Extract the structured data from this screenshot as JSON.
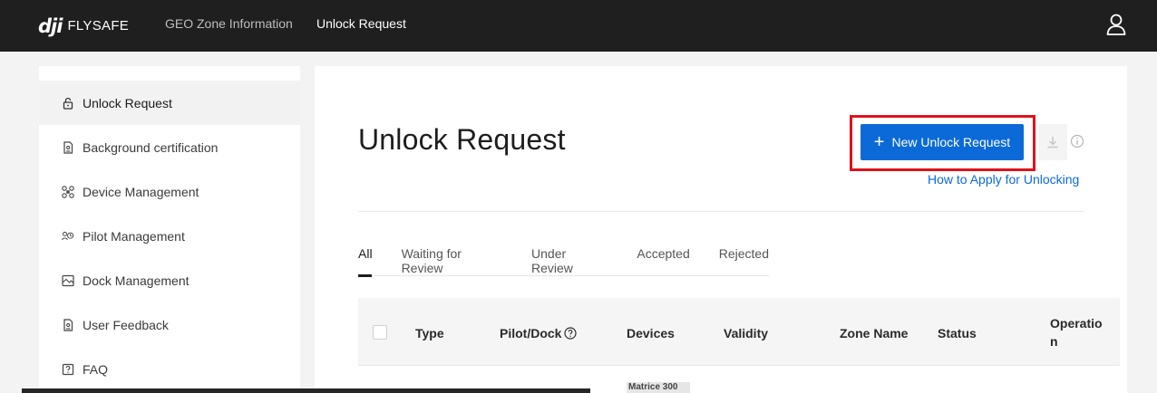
{
  "header": {
    "logo_mark": "dji",
    "logo_text": "FLYSAFE",
    "nav": [
      {
        "label": "GEO Zone Information",
        "active": false
      },
      {
        "label": "Unlock Request",
        "active": true
      }
    ],
    "user_icon": "user-icon"
  },
  "sidebar": {
    "items": [
      {
        "label": "Unlock Request",
        "icon": "lock-icon",
        "active": true
      },
      {
        "label": "Background certification",
        "icon": "document-icon",
        "active": false
      },
      {
        "label": "Device Management",
        "icon": "drone-icon",
        "active": false
      },
      {
        "label": "Pilot Management",
        "icon": "pilot-icon",
        "active": false
      },
      {
        "label": "Dock Management",
        "icon": "dock-icon",
        "active": false
      },
      {
        "label": "User Feedback",
        "icon": "feedback-icon",
        "active": false
      },
      {
        "label": "FAQ",
        "icon": "faq-icon",
        "active": false
      }
    ]
  },
  "main": {
    "title": "Unlock Request",
    "new_button_label": "New Unlock Request",
    "how_to_link": "How to Apply for Unlocking",
    "tabs": [
      {
        "label": "All",
        "active": true
      },
      {
        "label": "Waiting for Review",
        "active": false
      },
      {
        "label": "Under Review",
        "active": false
      },
      {
        "label": "Accepted",
        "active": false
      },
      {
        "label": "Rejected",
        "active": false
      }
    ],
    "table": {
      "columns": [
        "Type",
        "Pilot/Dock",
        "Devices",
        "Validity",
        "Zone Name",
        "Status",
        "Operatio",
        "n"
      ]
    },
    "first_row_device_chip": "Matrice 300"
  },
  "colors": {
    "topbar": "#1f1f1f",
    "primary": "#0b6ad8",
    "highlight": "#e0121c"
  }
}
